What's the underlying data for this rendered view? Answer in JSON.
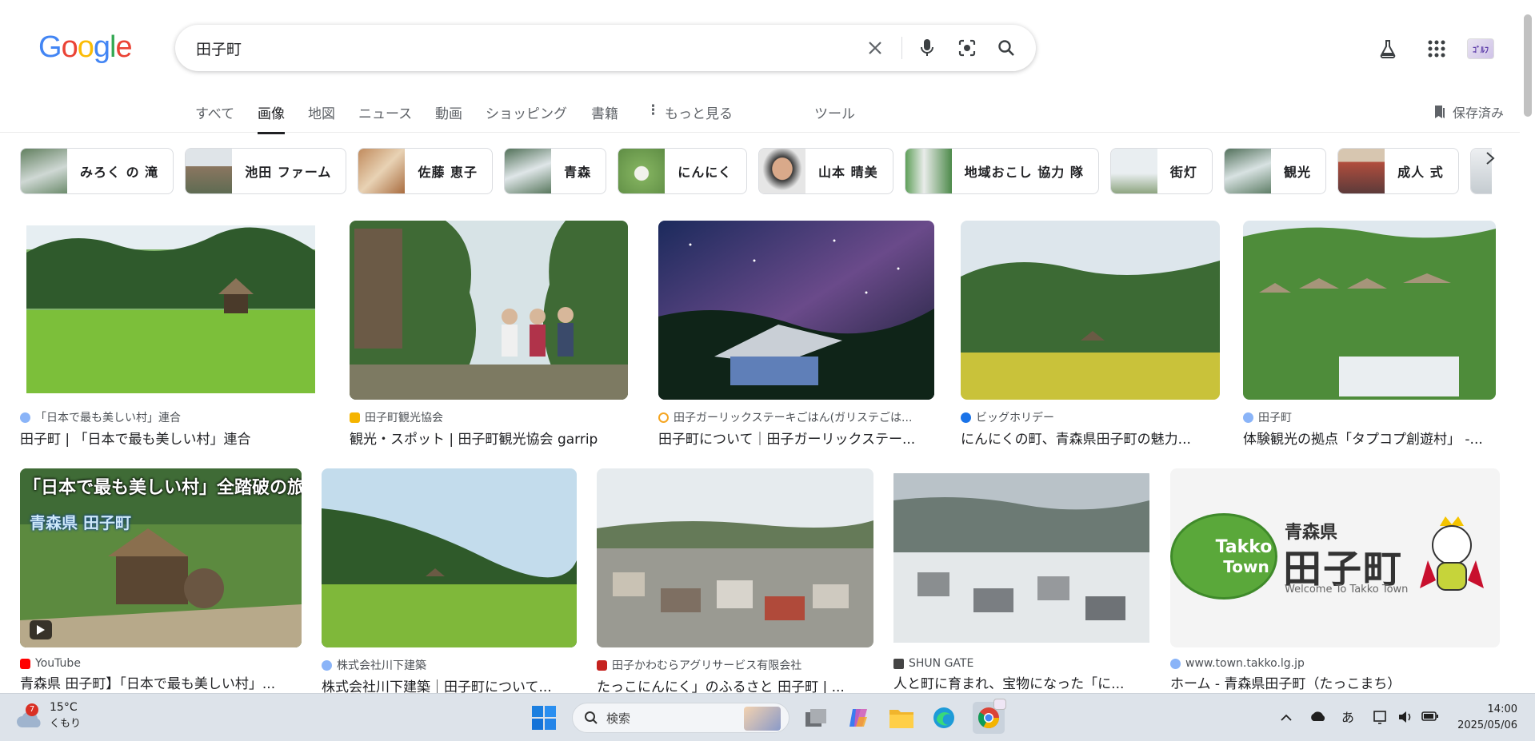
{
  "header": {
    "logo_letters": [
      "G",
      "o",
      "o",
      "g",
      "l",
      "e"
    ],
    "query": "田子町",
    "avatar_text": "ｺﾞﾙﾌ"
  },
  "tabs": {
    "items": [
      "すべて",
      "画像",
      "地図",
      "ニュース",
      "動画",
      "ショッピング",
      "書籍",
      "もっと見る",
      "ツール"
    ],
    "active": "画像",
    "saved": "保存済み"
  },
  "chips": [
    {
      "label": "みろく の 滝",
      "thumb": "#7a9a84"
    },
    {
      "label": "池田 ファーム",
      "thumb": "#9a8a76"
    },
    {
      "label": "佐藤 恵子",
      "thumb": "#a87d56"
    },
    {
      "label": "青森",
      "thumb": "#6e8f9a"
    },
    {
      "label": "にんにく",
      "thumb": "#8fb36a"
    },
    {
      "label": "山本 晴美",
      "thumb": "#c9b6a4"
    },
    {
      "label": "地域おこし 協力 隊",
      "thumb": "#7fa87a"
    },
    {
      "label": "街灯",
      "thumb": "#b8c4c9"
    },
    {
      "label": "観光",
      "thumb": "#6f8c8f"
    },
    {
      "label": "成人 式",
      "thumb": "#a86a5a"
    },
    {
      "label": "",
      "thumb": "#d6dadc"
    }
  ],
  "results_row1": [
    {
      "source": "「日本で最も美しい村」連合",
      "title": "田子町 | 「日本で最も美しい村」連合",
      "fav": "#8ab4f8"
    },
    {
      "source": "田子町観光協会",
      "title": "観光・スポット | 田子町観光協会 garrip",
      "fav": "#f5b400"
    },
    {
      "source": "田子ガーリックステーキごはん(ガリステごは...",
      "title": "田子町について｜田子ガーリックステー...",
      "fav": "#f5a623"
    },
    {
      "source": "ビッグホリデー",
      "title": "にんにくの町、青森県田子町の魅力...",
      "fav": "#1a73e8"
    },
    {
      "source": "田子町",
      "title": "体験観光の拠点「タプコプ創遊村」 -...",
      "fav": "#8ab4f8"
    }
  ],
  "results_row2": [
    {
      "source": "YouTube",
      "title": "青森県 田子町】「日本で最も美しい村」...",
      "fav": "#ff0000",
      "overlay_title": "「日本で最も美しい村」全踏破の旅",
      "overlay_sub": "青森県 田子町"
    },
    {
      "source": "株式会社川下建築",
      "title": "株式会社川下建築｜田子町について...",
      "fav": "#8ab4f8"
    },
    {
      "source": "田子かわむらアグリサービス有限会社",
      "title": "たっこにんにく」のふるさと 田子町 | ...",
      "fav": "#c5221f"
    },
    {
      "source": "SHUN GATE",
      "title": "人と町に育まれ、宝物になった「に...",
      "fav": "#444444"
    },
    {
      "source": "www.town.takko.lg.jp",
      "title": "ホーム - 青森県田子町（たっこまち）",
      "fav": "#8ab4f8",
      "logo_pref": "青森県",
      "logo_town": "田子町",
      "logo_en": "Welcome To Takko Town",
      "logo_circle1": "Takko",
      "logo_circle2": "Town"
    }
  ],
  "taskbar": {
    "weather_badge": "7",
    "temperature": "15°C",
    "condition": "くもり",
    "search_placeholder": "検索",
    "ime": "あ",
    "time": "14:00",
    "date": "2025/05/06"
  }
}
